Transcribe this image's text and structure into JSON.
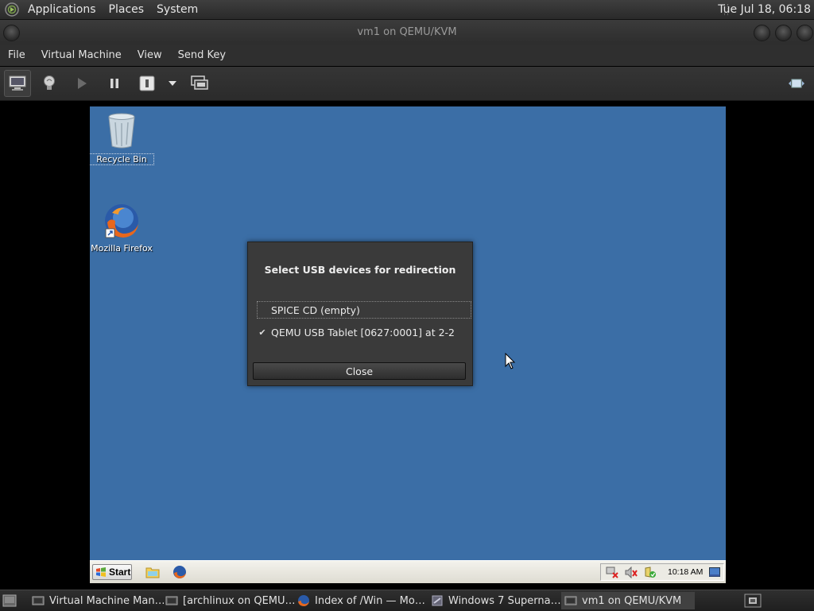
{
  "top_panel": {
    "menus": [
      "Applications",
      "Places",
      "System"
    ],
    "clock": "Tue Jul 18, 06:18"
  },
  "window": {
    "title": "vm1 on QEMU/KVM"
  },
  "menubar": [
    "File",
    "Virtual Machine",
    "View",
    "Send Key"
  ],
  "toolbar": {
    "buttons": [
      "console-icon",
      "lightbulb-icon",
      "play-icon",
      "pause-icon",
      "power-icon",
      "dropdown-arrow-icon",
      "snapshot-icon",
      "fullscreen-icon"
    ]
  },
  "guest": {
    "desktop_icons": [
      {
        "label": "Recycle Bin",
        "icon": "recycle-bin-icon"
      },
      {
        "label": "Mozilla Firefox",
        "icon": "firefox-icon"
      }
    ],
    "usb_dialog": {
      "heading": "Select USB devices for redirection",
      "devices": [
        {
          "label": "SPICE CD (empty)",
          "checked": false
        },
        {
          "label": "QEMU USB Tablet [0627:0001] at 2-2",
          "checked": true
        }
      ],
      "close_label": "Close"
    },
    "taskbar": {
      "start_label": "Start",
      "clock": "10:18 AM"
    }
  },
  "bottom_panel": {
    "tasks": [
      {
        "label": "Virtual Machine Man…",
        "icon": "vmm-icon",
        "active": false
      },
      {
        "label": "[archlinux on QEMU…",
        "icon": "vm-icon",
        "active": false
      },
      {
        "label": "Index of /Win — Mo…",
        "icon": "firefox-icon",
        "active": false
      },
      {
        "label": "Windows 7 Superna…",
        "icon": "app-icon",
        "active": false
      },
      {
        "label": "vm1 on QEMU/KVM",
        "icon": "vm-icon",
        "active": true
      }
    ]
  },
  "colors": {
    "guest_desktop": "#3b6ea6",
    "panel": "#2f2f2f"
  }
}
